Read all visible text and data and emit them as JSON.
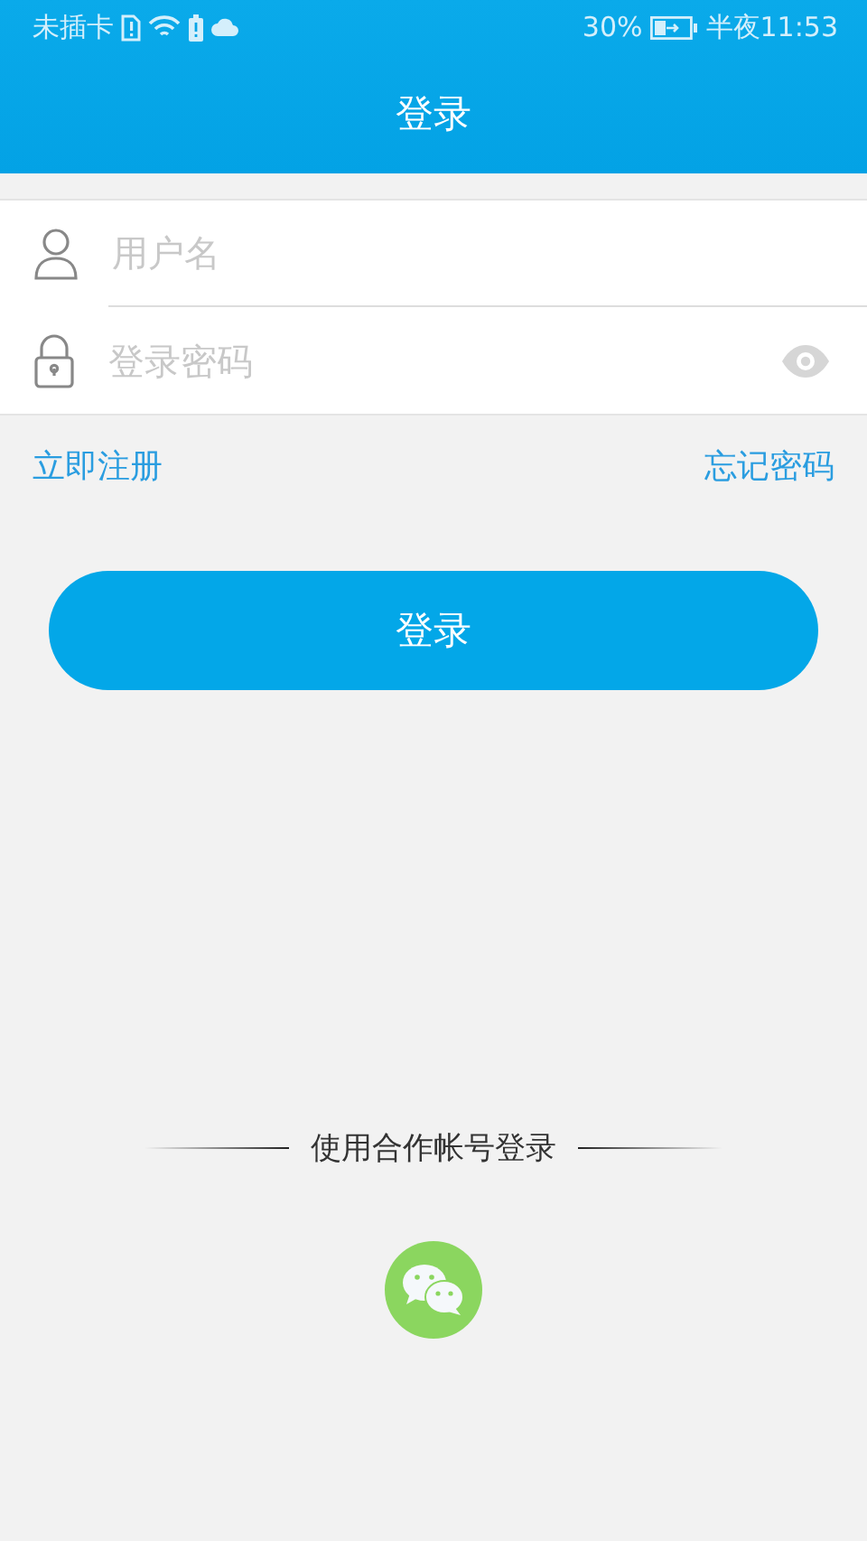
{
  "status_bar": {
    "carrier": "未插卡",
    "battery": "30%",
    "time": "半夜11:53"
  },
  "title": "登录",
  "fields": [
    {
      "kind": "user",
      "placeholder": "用户名"
    },
    {
      "kind": "password",
      "placeholder": "登录密码"
    }
  ],
  "links": {
    "register": "立即注册",
    "forgot": "忘记密码"
  },
  "login_button": "登录",
  "partner": {
    "label": "使用合作帐号登录"
  }
}
